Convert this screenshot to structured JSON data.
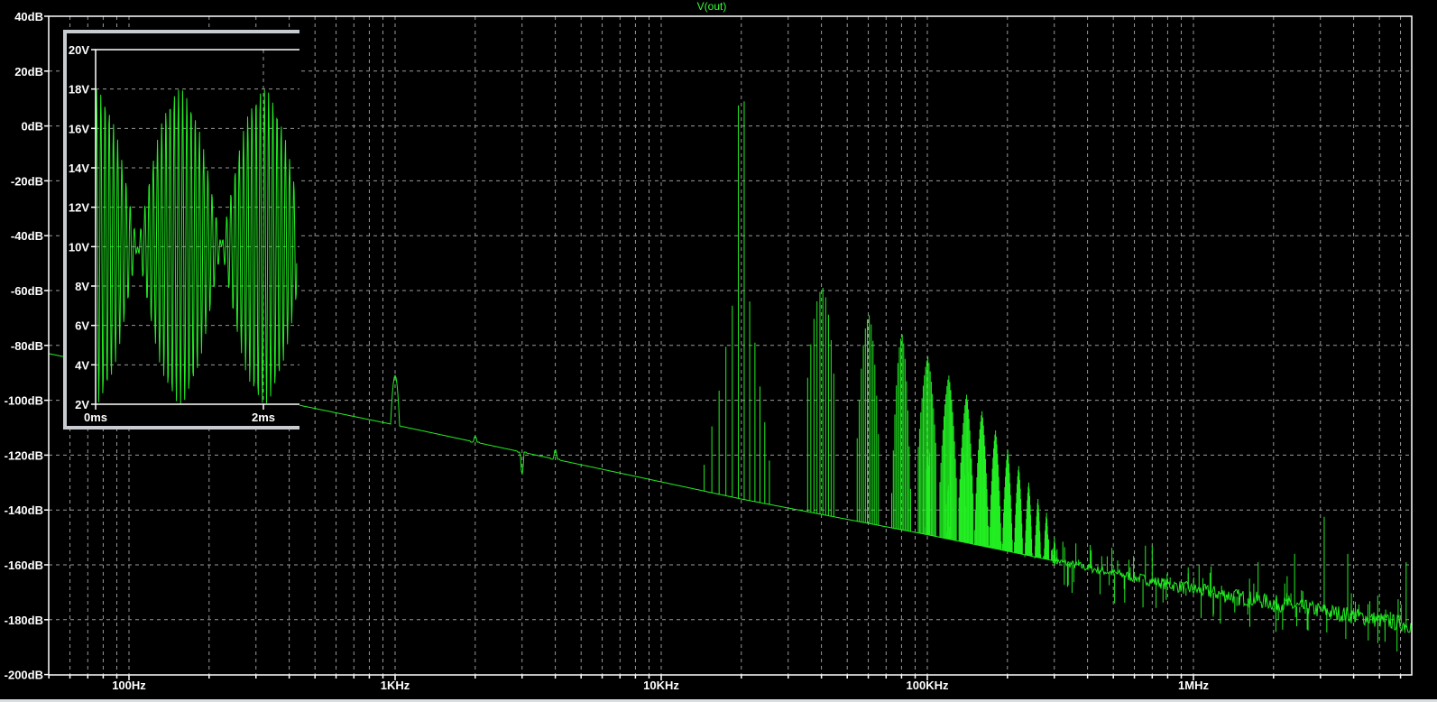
{
  "title": "V(out)",
  "chart_data": [
    {
      "type": "line",
      "name": "fft-spectrum",
      "title": "V(out)",
      "xscale": "log",
      "xlim_hz": [
        50,
        6570000
      ],
      "ylim_db": [
        -200,
        40
      ],
      "grid": true,
      "x_ticks": [
        {
          "value": 100,
          "label": "100Hz"
        },
        {
          "value": 1000,
          "label": "1KHz"
        },
        {
          "value": 10000,
          "label": "10KHz"
        },
        {
          "value": 100000,
          "label": "100KHz"
        },
        {
          "value": 1000000,
          "label": "1MHz"
        }
      ],
      "y_ticks": [
        {
          "value": 40,
          "label": "40dB"
        },
        {
          "value": 20,
          "label": "20dB"
        },
        {
          "value": 0,
          "label": "0dB"
        },
        {
          "value": -20,
          "label": "-20dB"
        },
        {
          "value": -40,
          "label": "-40dB"
        },
        {
          "value": -60,
          "label": "-60dB"
        },
        {
          "value": -80,
          "label": "-80dB"
        },
        {
          "value": -100,
          "label": "-100dB"
        },
        {
          "value": -120,
          "label": "-120dB"
        },
        {
          "value": -140,
          "label": "-140dB"
        },
        {
          "value": -160,
          "label": "-160dB"
        },
        {
          "value": -180,
          "label": "-180dB"
        },
        {
          "value": -200,
          "label": "-200dB"
        }
      ],
      "noise_floor": [
        [
          50,
          -83
        ],
        [
          1000,
          -109
        ],
        [
          20000,
          -136
        ],
        [
          100000,
          -149
        ],
        [
          1000000,
          -169
        ],
        [
          6570000,
          -182
        ]
      ],
      "low_freq_features": [
        [
          1000,
          -91
        ],
        [
          2000,
          -113
        ],
        [
          3000,
          -127
        ],
        [
          4000,
          -118
        ]
      ],
      "sideband_spacing_hz": 1000,
      "clusters": [
        {
          "center_hz": 20000,
          "peak_db": 9
        },
        {
          "center_hz": 40000,
          "peak_db": -59
        },
        {
          "center_hz": 60000,
          "peak_db": -69
        },
        {
          "center_hz": 80000,
          "peak_db": -76
        },
        {
          "center_hz": 100000,
          "peak_db": -84
        },
        {
          "center_hz": 120000,
          "peak_db": -91
        },
        {
          "center_hz": 140000,
          "peak_db": -98
        },
        {
          "center_hz": 160000,
          "peak_db": -104
        },
        {
          "center_hz": 180000,
          "peak_db": -111
        },
        {
          "center_hz": 200000,
          "peak_db": -118
        },
        {
          "center_hz": 220000,
          "peak_db": -124
        },
        {
          "center_hz": 240000,
          "peak_db": -130
        },
        {
          "center_hz": 260000,
          "peak_db": -136
        },
        {
          "center_hz": 280000,
          "peak_db": -141
        },
        {
          "center_hz": 300000,
          "peak_db": -150
        }
      ],
      "fundamental_sidebands_db": [
        9,
        -64,
        -79,
        -95,
        -108,
        -122
      ],
      "spurs": [
        [
          660000,
          -153
        ],
        [
          700000,
          -153
        ],
        [
          1050000,
          -160
        ],
        [
          1750000,
          -159
        ],
        [
          2400000,
          -156
        ],
        [
          3100000,
          -142.5
        ],
        [
          3800000,
          -156
        ],
        [
          6300000,
          -159
        ]
      ]
    },
    {
      "type": "line",
      "name": "time-domain-inset",
      "xlabel_unit": "ms",
      "xlim_ms": [
        0,
        2.4
      ],
      "ylim_v": [
        2,
        20
      ],
      "x_ticks": [
        {
          "value": 0,
          "label": "0ms"
        },
        {
          "value": 2,
          "label": "2ms"
        }
      ],
      "y_ticks": [
        {
          "value": 20,
          "label": "20V"
        },
        {
          "value": 18,
          "label": "18V"
        },
        {
          "value": 16,
          "label": "16V"
        },
        {
          "value": 14,
          "label": "14V"
        },
        {
          "value": 12,
          "label": "12V"
        },
        {
          "value": 10,
          "label": "10V"
        },
        {
          "value": 8,
          "label": "8V"
        },
        {
          "value": 6,
          "label": "6V"
        },
        {
          "value": 4,
          "label": "4V"
        },
        {
          "value": 2,
          "label": "2V"
        }
      ],
      "signal": {
        "offset_v": 10,
        "amplitude_v": 8,
        "envelope_hz": 500,
        "carrier_hz": 20000
      }
    }
  ],
  "colors": {
    "trace": "#22ee22",
    "title": "#33ff33",
    "grid": "#9a9a9a",
    "axis": "#ffffff",
    "background": "#000000",
    "inset_frame": "#c8ccd0"
  }
}
